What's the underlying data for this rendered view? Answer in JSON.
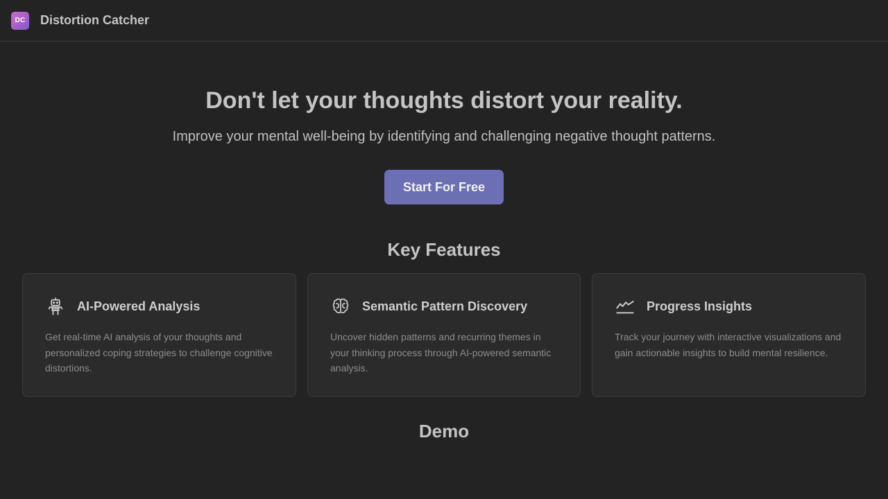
{
  "app": {
    "logo_text": "DC",
    "title": "Distortion Catcher"
  },
  "hero": {
    "title": "Don't let your thoughts distort your reality.",
    "subtitle": "Improve your mental well-being by identifying and challenging negative thought patterns.",
    "cta_label": "Start For Free"
  },
  "features": {
    "heading": "Key Features",
    "items": [
      {
        "icon": "robot-icon",
        "title": "AI-Powered Analysis",
        "description": "Get real-time AI analysis of your thoughts and personalized coping strategies to challenge cognitive distortions."
      },
      {
        "icon": "brain-icon",
        "title": "Semantic Pattern Discovery",
        "description": "Uncover hidden patterns and recurring themes in your thinking process through AI-powered semantic analysis."
      },
      {
        "icon": "line-chart-icon",
        "title": "Progress Insights",
        "description": "Track your journey with interactive visualizations and gain actionable insights to build mental resilience."
      }
    ]
  },
  "demo": {
    "heading": "Demo"
  },
  "colors": {
    "background": "#232323",
    "card": "#2b2b2b",
    "accent": "#6d6fb5",
    "logo_gradient_start": "#c86bd0",
    "logo_gradient_end": "#7a5bd2"
  }
}
